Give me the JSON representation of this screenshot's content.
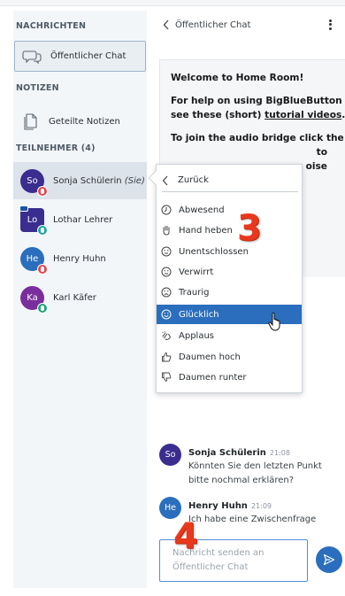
{
  "sidebar": {
    "messages_title": "NACHRICHTEN",
    "public_chat_label": "Öffentlicher Chat",
    "notes_title": "NOTIZEN",
    "shared_notes_label": "Geteilte Notizen",
    "participants_title": "TEILNEHMER (4)",
    "users": [
      {
        "initials": "So",
        "name": "Sonja Schülerin",
        "suffix": "(Sie)",
        "color": "#3a2d8f",
        "badge_color": "#e5484d"
      },
      {
        "initials": "Lo",
        "name": "Lothar Lehrer",
        "suffix": "",
        "color": "#3a2d8f",
        "badge_color": "#20a6a0"
      },
      {
        "initials": "He",
        "name": "Henry Huhn",
        "suffix": "",
        "color": "#2a6ebd",
        "badge_color": "#e5484d"
      },
      {
        "initials": "Ka",
        "name": "Karl Käfer",
        "suffix": "",
        "color": "#7a2d9c",
        "badge_color": "#20a67a"
      }
    ]
  },
  "chat": {
    "header_label": "Öffentlicher Chat",
    "welcome_line1_prefix": "Welcome to ",
    "welcome_line1_bold": "Home Room",
    "welcome_line1_suffix": "!",
    "welcome_help_1": "For help on using BigBlueButton",
    "welcome_help_2_prefix": "see these (short) ",
    "welcome_help_link": "tutorial videos",
    "welcome_help_2_suffix": ".",
    "welcome_audio_1": "To join the audio bridge click the",
    "welcome_audio_2": "to",
    "welcome_audio_3": "oise",
    "messages": [
      {
        "initials": "So",
        "color": "#3a2d8f",
        "name": "Sonja Schülerin",
        "time": "21:08",
        "lines": [
          "Könnten Sie den letzten Punkt",
          "bitte nochmal erklären?"
        ]
      },
      {
        "initials": "He",
        "color": "#2a6ebd",
        "name": "Henry Huhn",
        "time": "21:09",
        "lines": [
          "Ich habe eine Zwischenfrage"
        ]
      }
    ],
    "input_line1": "Nachricht senden an",
    "input_line2": "Öffentlicher Chat"
  },
  "status_menu": {
    "back_label": "Zurück",
    "items": [
      {
        "label": "Abwesend",
        "icon": "clock-icon"
      },
      {
        "label": "Hand heben",
        "icon": "hand-icon"
      },
      {
        "label": "Unentschlossen",
        "icon": "neutral-face-icon"
      },
      {
        "label": "Verwirrt",
        "icon": "confused-face-icon"
      },
      {
        "label": "Traurig",
        "icon": "sad-face-icon"
      },
      {
        "label": "Glücklich",
        "icon": "happy-face-icon",
        "active": true
      },
      {
        "label": "Applaus",
        "icon": "applause-icon"
      },
      {
        "label": "Daumen hoch",
        "icon": "thumbs-up-icon"
      },
      {
        "label": "Daumen runter",
        "icon": "thumbs-down-icon"
      }
    ]
  },
  "annotations": {
    "step3": "3",
    "step4": "4"
  },
  "colors": {
    "accent": "#2a6ebd",
    "annotation": "#e8391d"
  }
}
